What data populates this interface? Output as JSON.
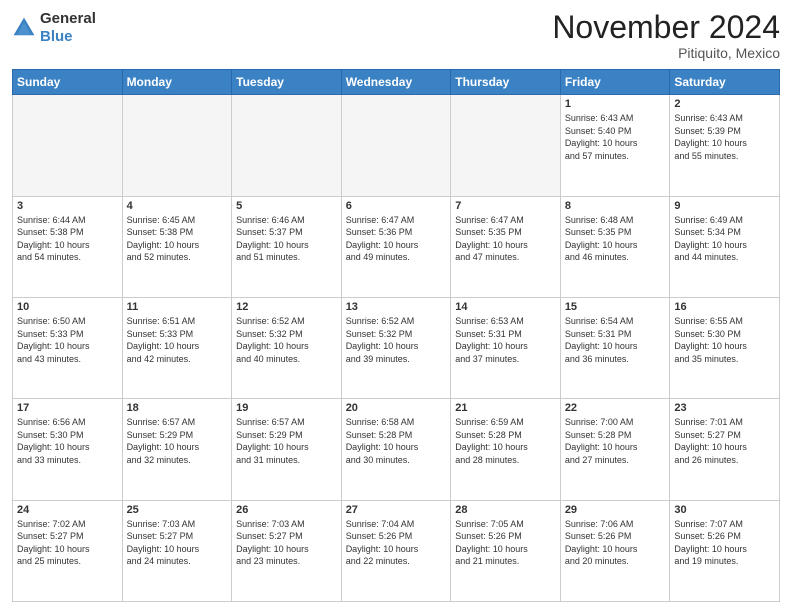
{
  "header": {
    "logo_line1": "General",
    "logo_line2": "Blue",
    "month": "November 2024",
    "location": "Pitiquito, Mexico"
  },
  "weekdays": [
    "Sunday",
    "Monday",
    "Tuesday",
    "Wednesday",
    "Thursday",
    "Friday",
    "Saturday"
  ],
  "weeks": [
    [
      {
        "day": "",
        "info": ""
      },
      {
        "day": "",
        "info": ""
      },
      {
        "day": "",
        "info": ""
      },
      {
        "day": "",
        "info": ""
      },
      {
        "day": "",
        "info": ""
      },
      {
        "day": "1",
        "info": "Sunrise: 6:43 AM\nSunset: 5:40 PM\nDaylight: 10 hours\nand 57 minutes."
      },
      {
        "day": "2",
        "info": "Sunrise: 6:43 AM\nSunset: 5:39 PM\nDaylight: 10 hours\nand 55 minutes."
      }
    ],
    [
      {
        "day": "3",
        "info": "Sunrise: 6:44 AM\nSunset: 5:38 PM\nDaylight: 10 hours\nand 54 minutes."
      },
      {
        "day": "4",
        "info": "Sunrise: 6:45 AM\nSunset: 5:38 PM\nDaylight: 10 hours\nand 52 minutes."
      },
      {
        "day": "5",
        "info": "Sunrise: 6:46 AM\nSunset: 5:37 PM\nDaylight: 10 hours\nand 51 minutes."
      },
      {
        "day": "6",
        "info": "Sunrise: 6:47 AM\nSunset: 5:36 PM\nDaylight: 10 hours\nand 49 minutes."
      },
      {
        "day": "7",
        "info": "Sunrise: 6:47 AM\nSunset: 5:35 PM\nDaylight: 10 hours\nand 47 minutes."
      },
      {
        "day": "8",
        "info": "Sunrise: 6:48 AM\nSunset: 5:35 PM\nDaylight: 10 hours\nand 46 minutes."
      },
      {
        "day": "9",
        "info": "Sunrise: 6:49 AM\nSunset: 5:34 PM\nDaylight: 10 hours\nand 44 minutes."
      }
    ],
    [
      {
        "day": "10",
        "info": "Sunrise: 6:50 AM\nSunset: 5:33 PM\nDaylight: 10 hours\nand 43 minutes."
      },
      {
        "day": "11",
        "info": "Sunrise: 6:51 AM\nSunset: 5:33 PM\nDaylight: 10 hours\nand 42 minutes."
      },
      {
        "day": "12",
        "info": "Sunrise: 6:52 AM\nSunset: 5:32 PM\nDaylight: 10 hours\nand 40 minutes."
      },
      {
        "day": "13",
        "info": "Sunrise: 6:52 AM\nSunset: 5:32 PM\nDaylight: 10 hours\nand 39 minutes."
      },
      {
        "day": "14",
        "info": "Sunrise: 6:53 AM\nSunset: 5:31 PM\nDaylight: 10 hours\nand 37 minutes."
      },
      {
        "day": "15",
        "info": "Sunrise: 6:54 AM\nSunset: 5:31 PM\nDaylight: 10 hours\nand 36 minutes."
      },
      {
        "day": "16",
        "info": "Sunrise: 6:55 AM\nSunset: 5:30 PM\nDaylight: 10 hours\nand 35 minutes."
      }
    ],
    [
      {
        "day": "17",
        "info": "Sunrise: 6:56 AM\nSunset: 5:30 PM\nDaylight: 10 hours\nand 33 minutes."
      },
      {
        "day": "18",
        "info": "Sunrise: 6:57 AM\nSunset: 5:29 PM\nDaylight: 10 hours\nand 32 minutes."
      },
      {
        "day": "19",
        "info": "Sunrise: 6:57 AM\nSunset: 5:29 PM\nDaylight: 10 hours\nand 31 minutes."
      },
      {
        "day": "20",
        "info": "Sunrise: 6:58 AM\nSunset: 5:28 PM\nDaylight: 10 hours\nand 30 minutes."
      },
      {
        "day": "21",
        "info": "Sunrise: 6:59 AM\nSunset: 5:28 PM\nDaylight: 10 hours\nand 28 minutes."
      },
      {
        "day": "22",
        "info": "Sunrise: 7:00 AM\nSunset: 5:28 PM\nDaylight: 10 hours\nand 27 minutes."
      },
      {
        "day": "23",
        "info": "Sunrise: 7:01 AM\nSunset: 5:27 PM\nDaylight: 10 hours\nand 26 minutes."
      }
    ],
    [
      {
        "day": "24",
        "info": "Sunrise: 7:02 AM\nSunset: 5:27 PM\nDaylight: 10 hours\nand 25 minutes."
      },
      {
        "day": "25",
        "info": "Sunrise: 7:03 AM\nSunset: 5:27 PM\nDaylight: 10 hours\nand 24 minutes."
      },
      {
        "day": "26",
        "info": "Sunrise: 7:03 AM\nSunset: 5:27 PM\nDaylight: 10 hours\nand 23 minutes."
      },
      {
        "day": "27",
        "info": "Sunrise: 7:04 AM\nSunset: 5:26 PM\nDaylight: 10 hours\nand 22 minutes."
      },
      {
        "day": "28",
        "info": "Sunrise: 7:05 AM\nSunset: 5:26 PM\nDaylight: 10 hours\nand 21 minutes."
      },
      {
        "day": "29",
        "info": "Sunrise: 7:06 AM\nSunset: 5:26 PM\nDaylight: 10 hours\nand 20 minutes."
      },
      {
        "day": "30",
        "info": "Sunrise: 7:07 AM\nSunset: 5:26 PM\nDaylight: 10 hours\nand 19 minutes."
      }
    ]
  ]
}
